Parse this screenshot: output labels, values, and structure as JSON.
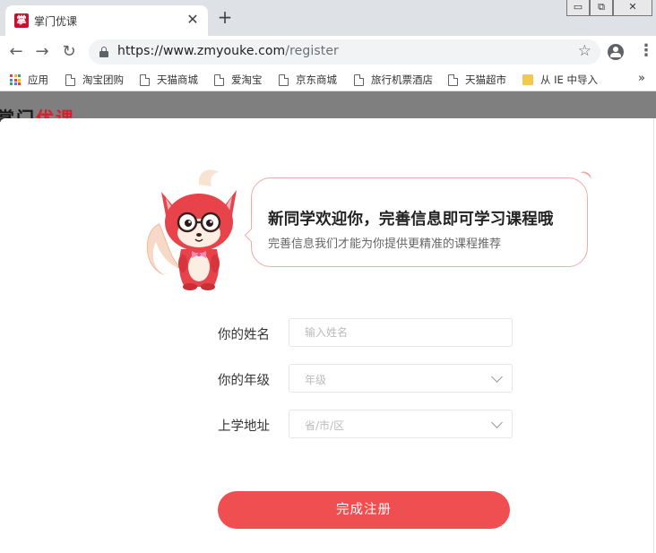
{
  "browser": {
    "tab_title": "掌门优课",
    "tab_favicon_char": "掌",
    "tab_close": "✕",
    "new_tab": "+",
    "window_controls": [
      "▭",
      "⧉",
      "✕"
    ],
    "url_base": "https://www.zmyouke.com",
    "url_path": "/register",
    "bookmarks": [
      {
        "label": "应用",
        "icon": "apps-icon"
      },
      {
        "label": "淘宝团购",
        "icon": "page-icon"
      },
      {
        "label": "天猫商城",
        "icon": "page-icon"
      },
      {
        "label": "爱淘宝",
        "icon": "page-icon"
      },
      {
        "label": "京东商城",
        "icon": "page-icon"
      },
      {
        "label": "旅行机票酒店",
        "icon": "page-icon"
      },
      {
        "label": "天猫超市",
        "icon": "page-icon"
      },
      {
        "label": "从 IE 中导入",
        "icon": "folder-icon"
      }
    ],
    "bookmarks_more": "»"
  },
  "page": {
    "logo_dark": "掌门",
    "logo_red": "优课"
  },
  "welcome": {
    "title": "新同学欢迎你，完善信息即可学习课程哦",
    "subtitle": "完善信息我们才能为你提供更精准的课程推荐"
  },
  "form": {
    "name_label": "你的姓名",
    "name_placeholder": "输入姓名",
    "grade_label": "你的年级",
    "grade_placeholder": "年级",
    "address_label": "上学地址",
    "address_placeholder": "省/市/区",
    "submit_label": "完成注册"
  },
  "colors": {
    "accent": "#ef4f50",
    "brand_red": "#d81e2c",
    "bubble_border": "#f3a9a9"
  }
}
